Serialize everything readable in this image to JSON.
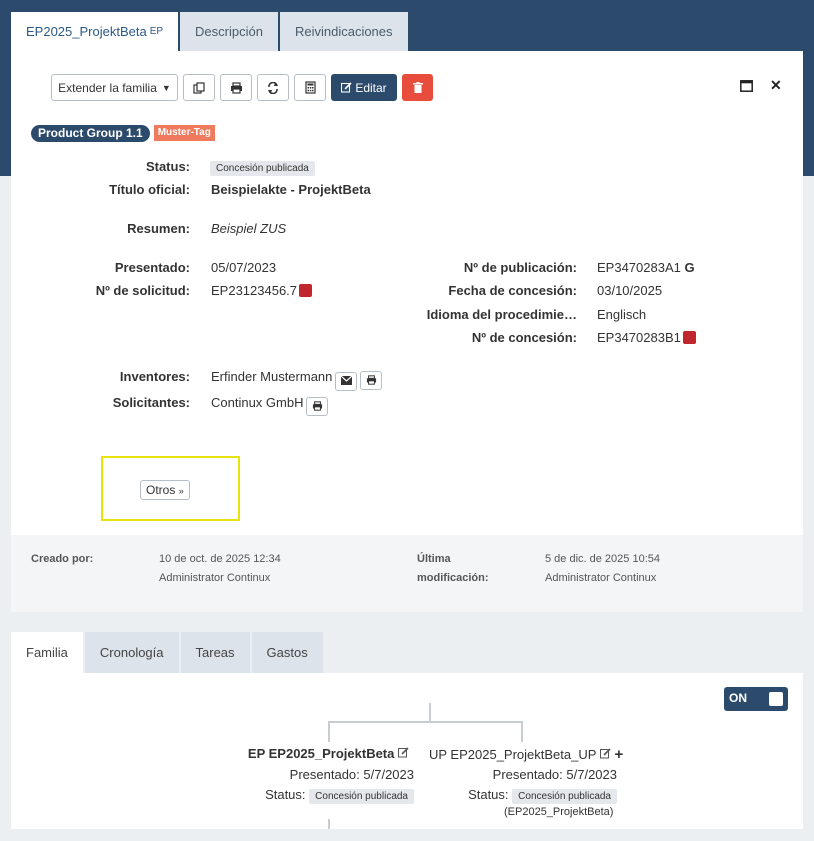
{
  "tabs_top": [
    {
      "label": "EP2025_ProjektBeta",
      "sub": "EP",
      "active": true
    },
    {
      "label": "Descripción",
      "sub": "",
      "active": false
    },
    {
      "label": "Reivindicaciones",
      "sub": "",
      "active": false
    }
  ],
  "toolbar": {
    "extend_label": "Extender la familia",
    "edit_label": "Editar"
  },
  "badges": {
    "group": "Product Group 1.1",
    "tag": "Muster-Tag"
  },
  "fields": {
    "status_label": "Status:",
    "status_value": "Concesión publicada",
    "title_label": "Título oficial:",
    "title_value": "Beispielakte - ProjektBeta",
    "summary_label": "Resumen:",
    "summary_value": "Beispiel ZUS",
    "filed_label": "Presentado:",
    "filed_value": "05/07/2023",
    "appno_label": "Nº de solicitud:",
    "appno_value": "EP23123456.7",
    "pubno_label": "Nº de publicación:",
    "pubno_value": "EP3470283A1",
    "grantdate_label": "Fecha de concesión:",
    "grantdate_value": "03/10/2025",
    "lang_label": "Idioma del procedimie…",
    "lang_value": "Englisch",
    "grantno_label": "Nº de concesión:",
    "grantno_value": "EP3470283B1",
    "inventors_label": "Inventores:",
    "inventors_value": "Erfinder Mustermann",
    "applicants_label": "Solicitantes:",
    "applicants_value": "Continux GmbH"
  },
  "otros_label": "Otros",
  "meta": {
    "created_label": "Creado por:",
    "created_date": "10 de oct. de 2025 12:34",
    "created_user": "Administrator Continux",
    "modified_label_1": "Última",
    "modified_label_2": "modificación:",
    "modified_date": "5 de dic. de 2025 10:54",
    "modified_user": "Administrator Continux"
  },
  "bottom_tabs": [
    {
      "label": "Familia",
      "active": true
    },
    {
      "label": "Cronología",
      "active": false
    },
    {
      "label": "Tareas",
      "active": false
    },
    {
      "label": "Gastos",
      "active": false
    }
  ],
  "toggle_label": "ON",
  "family": {
    "ep": {
      "title": "EP EP2025_ProjektBeta",
      "filed": "Presentado: 5/7/2023",
      "status_label": "Status:",
      "status_value": "Concesión publicada"
    },
    "up": {
      "title": "UP EP2025_ProjektBeta_UP",
      "filed": "Presentado: 5/7/2023",
      "status_label": "Status:",
      "status_value": "Concesión publicada",
      "parent_ref": "(EP2025_ProjektBeta)"
    }
  }
}
